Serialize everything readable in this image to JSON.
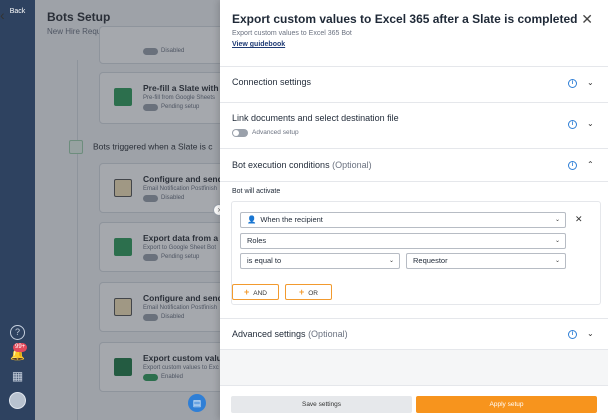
{
  "rail": {
    "back_label": "Back",
    "notification_count": "99+"
  },
  "background": {
    "title": "Bots Setup",
    "subtitle": "New Hire Request",
    "section_title": "Bots triggered when a Slate is c",
    "cards": [
      {
        "title": "",
        "subtitle": "",
        "status": "Disabled",
        "enabled": false,
        "icon": "excel-icon"
      },
      {
        "title": "Pre-fill a Slate with d",
        "subtitle": "Pre-fill from Google Sheets",
        "status": "Pending setup",
        "enabled": false,
        "icon": "sheets-icon"
      },
      {
        "title": "Configure and send",
        "subtitle": "Email Notification Postfinish",
        "status": "Disabled",
        "enabled": false,
        "icon": "email-icon"
      },
      {
        "title": "Export data from a",
        "subtitle": "Export to Google Sheet Bot",
        "status": "Pending setup",
        "enabled": false,
        "icon": "sheets-icon"
      },
      {
        "title": "Configure and send",
        "subtitle": "Email Notification Postfinish",
        "status": "Disabled",
        "enabled": false,
        "icon": "email-icon"
      },
      {
        "title": "Export custom valu",
        "subtitle": "Export custom values to Exc",
        "status": "Enabled",
        "enabled": true,
        "icon": "excel-icon"
      }
    ]
  },
  "panel": {
    "title": "Export custom values to Excel 365 after a Slate is completed",
    "subtitle": "Export custom values to Excel 365 Bot",
    "guidebook_link": "View guidebook",
    "sections": {
      "connection": {
        "label": "Connection settings"
      },
      "link_docs": {
        "label": "Link documents and select destination file",
        "toggle_label": "Advanced setup"
      },
      "execution": {
        "label": "Bot execution conditions",
        "optional": "(Optional)"
      },
      "advanced": {
        "label": "Advanced settings",
        "optional": "(Optional)"
      }
    },
    "conditions": {
      "heading": "Bot will activate",
      "recipient_select": "When the recipient",
      "role_select": "Roles",
      "operator_select": "is equal to",
      "value_select": "Requestor",
      "and_button": "AND",
      "or_button": "OR"
    },
    "footer": {
      "save_label": "Save settings",
      "apply_label": "Apply setup"
    }
  },
  "colors": {
    "accent": "#f7941d",
    "link": "#1f3b75",
    "info": "#2f7fd6",
    "rail": "#2e4260"
  }
}
